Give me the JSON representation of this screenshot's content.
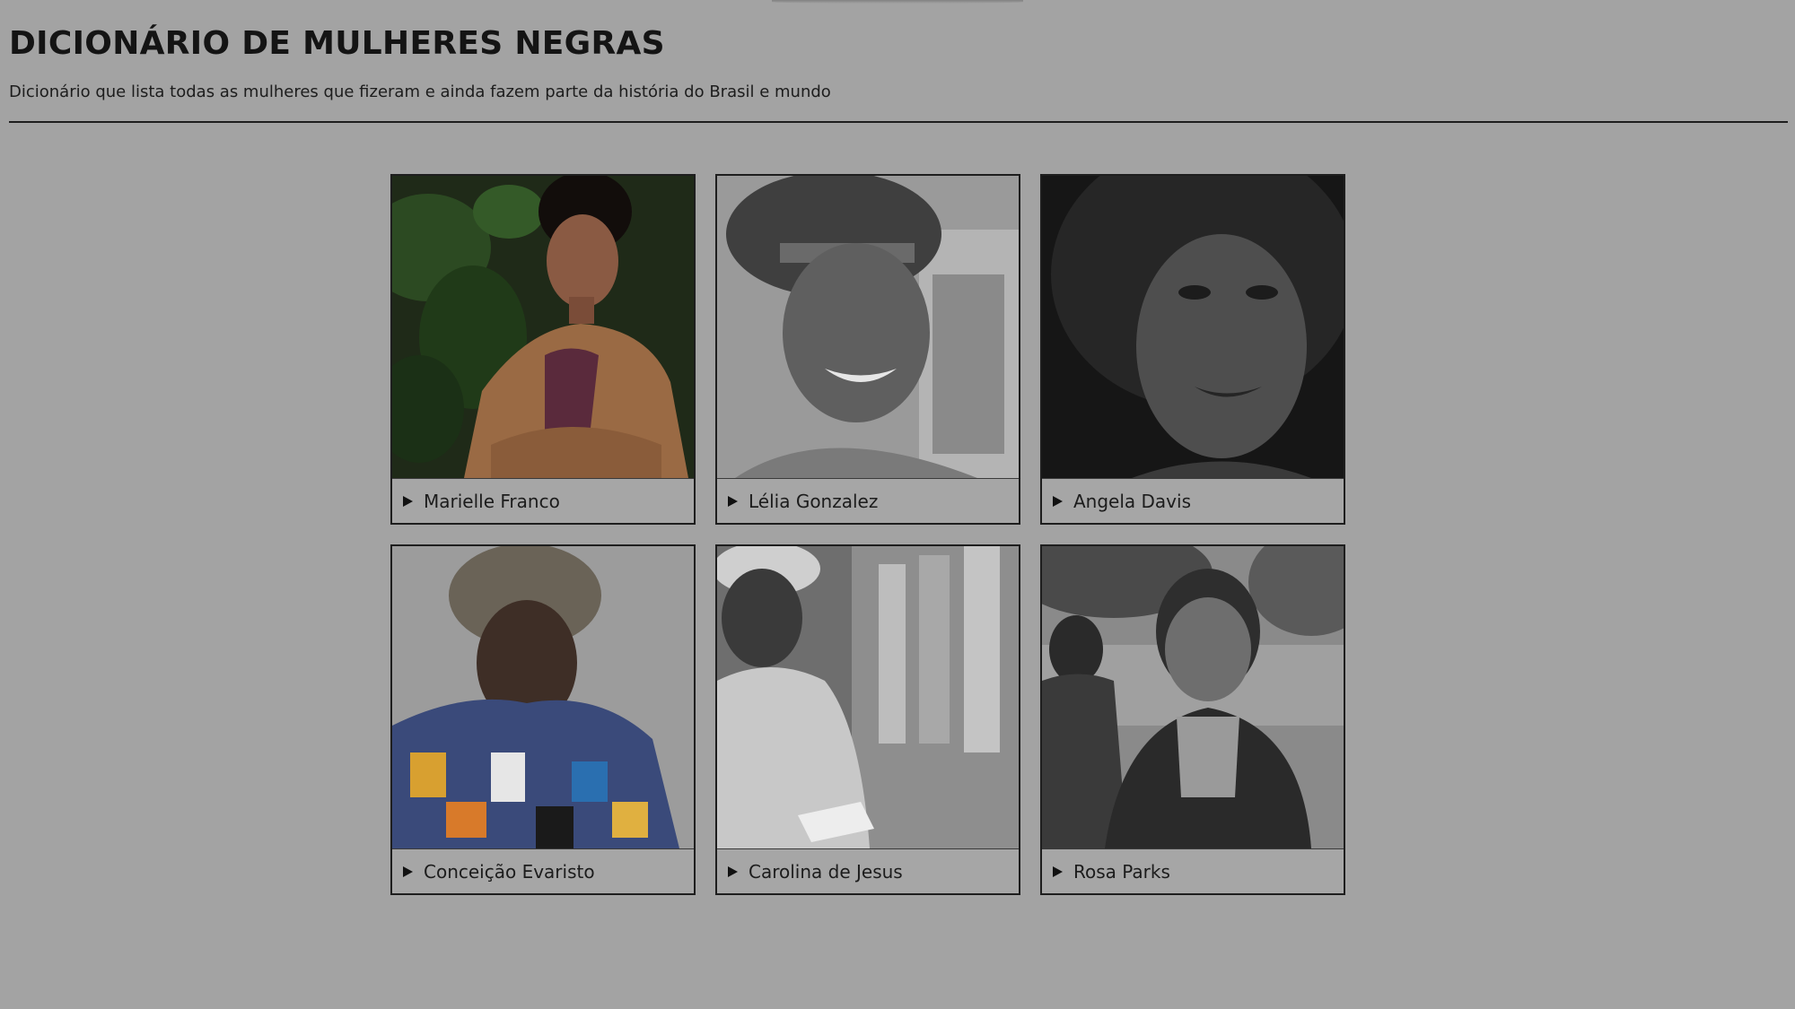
{
  "header": {
    "title": "DICIONÁRIO DE MULHERES NEGRAS",
    "subtitle": "Dicionário que lista todas as mulheres que fizeram e ainda fazem parte da história do Brasil e mundo"
  },
  "cards": [
    {
      "name": "Marielle Franco",
      "photo_style": "color"
    },
    {
      "name": "Lélia Gonzalez",
      "photo_style": "black-and-white"
    },
    {
      "name": "Angela Davis",
      "photo_style": "black-and-white"
    },
    {
      "name": "Conceição Evaristo",
      "photo_style": "color"
    },
    {
      "name": "Carolina de Jesus",
      "photo_style": "black-and-white"
    },
    {
      "name": "Rosa Parks",
      "photo_style": "black-and-white"
    }
  ],
  "icons": {
    "expand": "disclosure-triangle-icon"
  },
  "colors": {
    "page_background": "#a3a3a3",
    "text": "#141414",
    "border": "#1e1e1e"
  }
}
